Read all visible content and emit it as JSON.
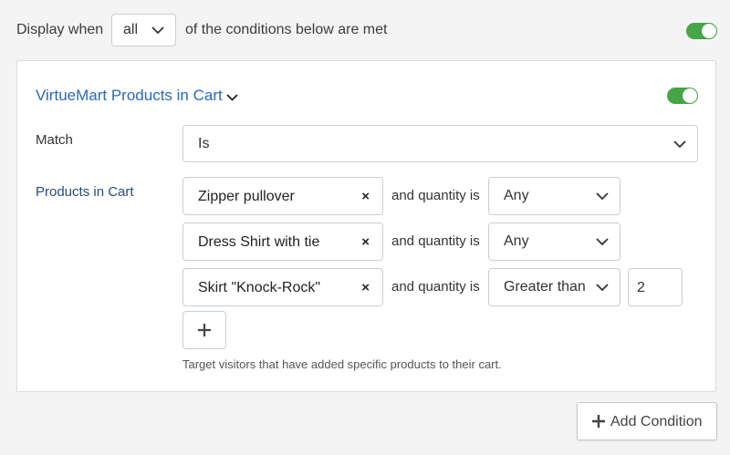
{
  "header": {
    "display_when_label": "Display when",
    "mode_select_value": "all",
    "conditions_text": "of the conditions below are met",
    "master_toggle_on": true
  },
  "condition": {
    "title": "VirtueMart Products in Cart",
    "enabled": true,
    "match_label": "Match",
    "match_value": "Is",
    "products_label": "Products in Cart",
    "quantity_text": "and quantity is",
    "rows": [
      {
        "product": "Zipper pullover",
        "remove": "×",
        "quantity_op": "Any"
      },
      {
        "product": "Dress Shirt with tie",
        "remove": "×",
        "quantity_op": "Any"
      },
      {
        "product": "Skirt \"Knock-Rock\"",
        "remove": "×",
        "quantity_op": "Greater than",
        "quantity_value": "2"
      }
    ],
    "help_text": "Target visitors that have added specific products to their cart."
  },
  "add_condition_label": "Add Condition",
  "colors": {
    "accent_blue": "#2a69b8",
    "toggle_green": "#46a546"
  },
  "icons": [
    "chevron-down-icon",
    "close-icon",
    "plus-icon"
  ]
}
